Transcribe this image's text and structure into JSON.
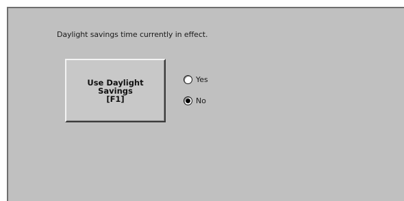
{
  "status": {
    "message": "Daylight savings time currently in effect."
  },
  "daylight_button": {
    "line1": "Use Daylight",
    "line2": "Savings",
    "line3": "[F1]"
  },
  "options": {
    "yes_label": "Yes",
    "no_label": "No",
    "selected": "No"
  },
  "colors": {
    "panel_background": "#c0c0c0",
    "page_background": "#ffffff",
    "button_face": "#c8c8c8",
    "text": "#1a1a1a"
  }
}
